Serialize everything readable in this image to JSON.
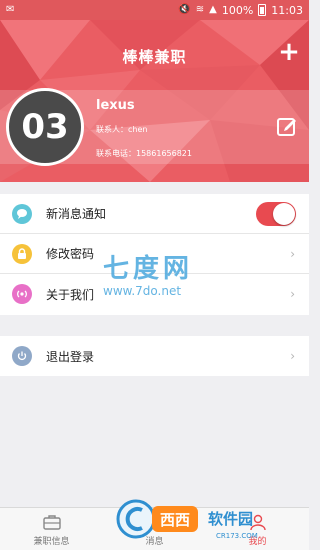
{
  "status_bar": {
    "battery": "100%",
    "time": "11:03"
  },
  "header": {
    "title": "棒棒兼职"
  },
  "profile": {
    "avatar_text": "03",
    "username": "lexus",
    "contact": "联系人：chen",
    "phone": "联系电话：15861656821"
  },
  "settings": [
    {
      "label": "新消息通知",
      "control": "toggle",
      "on": true,
      "icon": "chat-bubble-icon",
      "color": "#5fc6d8"
    },
    {
      "label": "修改密码",
      "control": "chevron",
      "icon": "lock-icon",
      "color": "#f6c23a"
    },
    {
      "label": "关于我们",
      "control": "chevron",
      "icon": "info-broadcast-icon",
      "color": "#e870c7"
    }
  ],
  "logout": {
    "label": "退出登录",
    "icon": "power-icon",
    "color": "#8fa8c8"
  },
  "watermark": {
    "line1": "七度网",
    "line2": "www.7do.net"
  },
  "bottom_nav": [
    {
      "label": "兼职信息",
      "icon": "briefcase-icon",
      "active": false
    },
    {
      "label": "消息",
      "icon": "message-icon",
      "active": false
    },
    {
      "label": "我的",
      "icon": "person-icon",
      "active": true
    }
  ],
  "badge": {
    "brand": "西西",
    "text": "软件园",
    "domain": "CR173.COM"
  }
}
